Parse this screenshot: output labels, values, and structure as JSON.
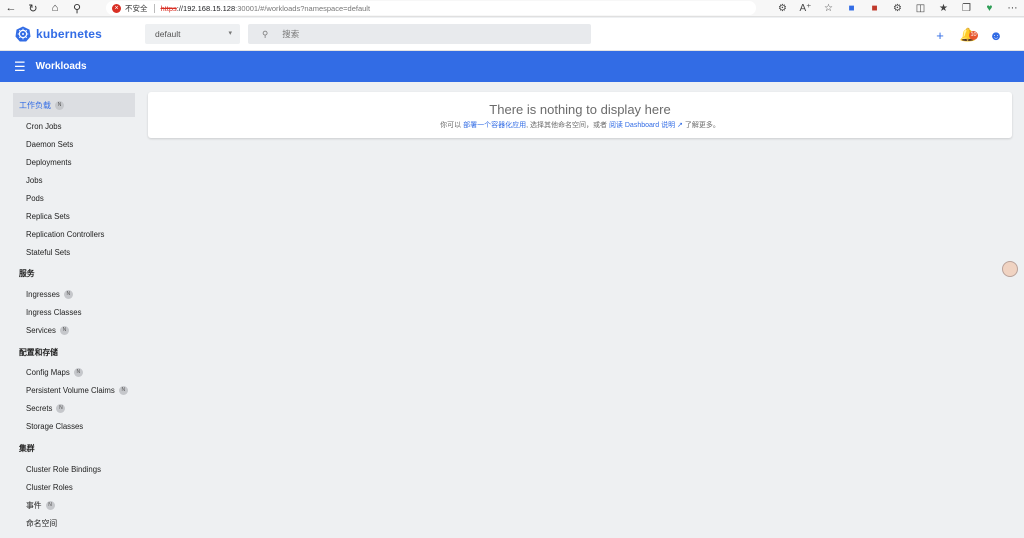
{
  "browser": {
    "insecure_label": "不安全",
    "url_scheme": "https",
    "url_host": "://192.168.15.128",
    "url_rest": ":30001/#/workloads?namespace=default"
  },
  "header": {
    "brand": "kubernetes",
    "namespace": "default",
    "search_placeholder": "搜索",
    "notification_count": "10"
  },
  "toolbar": {
    "title": "Workloads"
  },
  "sidebar": {
    "active_label": "工作负载",
    "workload_items": [
      "Cron Jobs",
      "Daemon Sets",
      "Deployments",
      "Jobs",
      "Pods",
      "Replica Sets",
      "Replication Controllers",
      "Stateful Sets"
    ],
    "service_category": "服务",
    "service_items": [
      "Ingresses",
      "Ingress Classes",
      "Services"
    ],
    "config_category": "配置和存储",
    "config_items": [
      "Config Maps",
      "Persistent Volume Claims",
      "Secrets",
      "Storage Classes"
    ],
    "cluster_category": "集群",
    "cluster_items": [
      "Cluster Role Bindings",
      "Cluster Roles",
      "事件",
      "命名空间"
    ],
    "badge": "N"
  },
  "empty_state": {
    "title": "There is nothing to display here",
    "desc_prefix": "你可以 ",
    "desc_link1": "部署一个容器化应用",
    "desc_middle": ", 选择其他命名空间，或者 ",
    "desc_link2": "阅读 Dashboard 说明",
    "desc_suffix": " 了解更多。"
  },
  "colors": {
    "accent": "#326ce5",
    "badge": "#e8572d"
  }
}
